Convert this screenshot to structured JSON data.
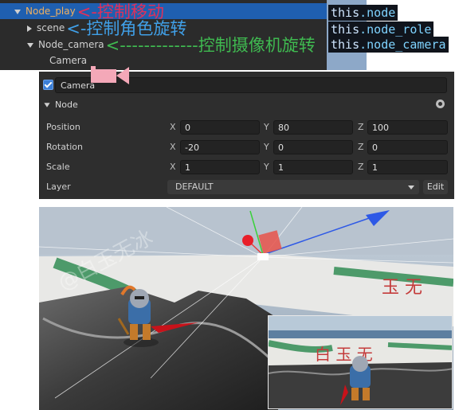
{
  "hierarchy": {
    "items": [
      {
        "label": "Node_play",
        "annotation": "<-控制移动"
      },
      {
        "label": "scene",
        "annotation": "<-控制角色旋转"
      },
      {
        "label": "Node_camera",
        "annotation": "<-------------控制摄像机旋转"
      },
      {
        "label": "Camera"
      }
    ]
  },
  "code_labels": {
    "this": "this",
    "line1": ".node",
    "line2": ".node_role",
    "line3": ".node_camera"
  },
  "inspector": {
    "name": "Camera",
    "component": "Node",
    "labels": {
      "position": "Position",
      "rotation": "Rotation",
      "scale": "Scale",
      "layer": "Layer"
    },
    "axes": {
      "x": "X",
      "y": "Y",
      "z": "Z"
    },
    "position": {
      "x": "0",
      "y": "80",
      "z": "100"
    },
    "rotation": {
      "x": "-20",
      "y": "0",
      "z": "0"
    },
    "scale": {
      "x": "1",
      "y": "1",
      "z": "1"
    },
    "layer": "DEFAULT",
    "edit": "Edit"
  },
  "watermark": "@白玉无冰",
  "colors": {
    "selected_row": "#1f5fb0",
    "annotation_red": "#e0305a",
    "annotation_blue": "#40a0e8",
    "annotation_green": "#3fb950",
    "accent": "#3b7fd8"
  },
  "icons": [
    "triangle-down-icon",
    "camera-icon",
    "gear-icon",
    "checkbox-icon",
    "dropdown-arrow-icon"
  ]
}
